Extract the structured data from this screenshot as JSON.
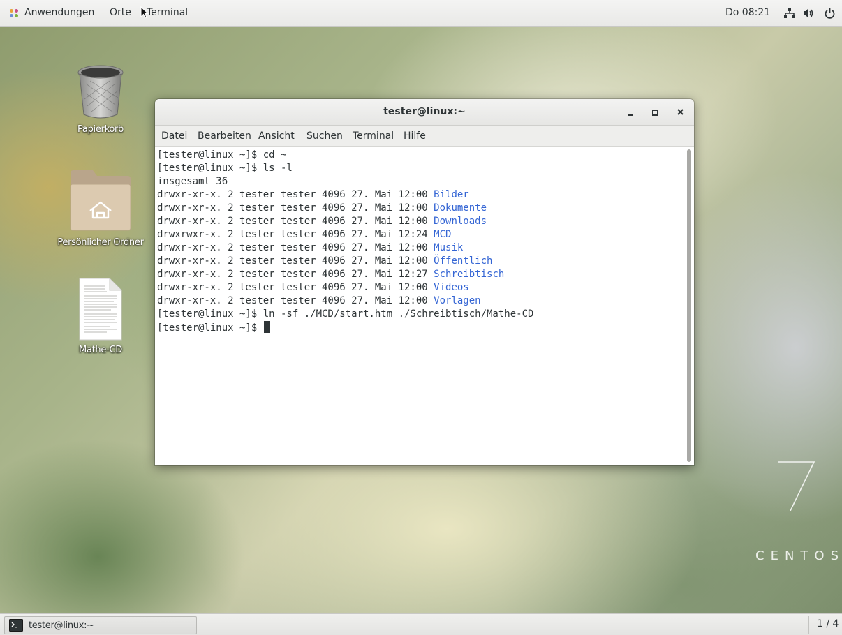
{
  "topbar": {
    "applications": "Anwendungen",
    "places": "Orte",
    "active_app": "Terminal",
    "clock": "Do 08:21"
  },
  "desktop": {
    "icons": [
      {
        "label": "Papierkorb",
        "icon": "trash-icon"
      },
      {
        "label": "Persönlicher Ordner",
        "icon": "home-folder-icon"
      },
      {
        "label": "Mathe-CD",
        "icon": "document-icon"
      }
    ],
    "logo": {
      "number": "7",
      "text": "CENTOS"
    }
  },
  "terminal": {
    "title": "tester@linux:~",
    "menu": [
      "Datei",
      "Bearbeiten",
      "Ansicht",
      "Suchen",
      "Terminal",
      "Hilfe"
    ],
    "lines": [
      {
        "text": "[tester@linux ~]$ cd ~",
        "name": ""
      },
      {
        "text": "[tester@linux ~]$ ls -l",
        "name": ""
      },
      {
        "text": "insgesamt 36",
        "name": ""
      },
      {
        "text": "drwxr-xr-x. 2 tester tester 4096 27. Mai 12:00 ",
        "name": "Bilder"
      },
      {
        "text": "drwxr-xr-x. 2 tester tester 4096 27. Mai 12:00 ",
        "name": "Dokumente"
      },
      {
        "text": "drwxr-xr-x. 2 tester tester 4096 27. Mai 12:00 ",
        "name": "Downloads"
      },
      {
        "text": "drwxrwxr-x. 2 tester tester 4096 27. Mai 12:24 ",
        "name": "MCD"
      },
      {
        "text": "drwxr-xr-x. 2 tester tester 4096 27. Mai 12:00 ",
        "name": "Musik"
      },
      {
        "text": "drwxr-xr-x. 2 tester tester 4096 27. Mai 12:00 ",
        "name": "Öffentlich"
      },
      {
        "text": "drwxr-xr-x. 2 tester tester 4096 27. Mai 12:27 ",
        "name": "Schreibtisch"
      },
      {
        "text": "drwxr-xr-x. 2 tester tester 4096 27. Mai 12:00 ",
        "name": "Videos"
      },
      {
        "text": "drwxr-xr-x. 2 tester tester 4096 27. Mai 12:00 ",
        "name": "Vorlagen"
      },
      {
        "text": "[tester@linux ~]$ ln -sf ./MCD/start.htm ./Schreibtisch/Mathe-CD",
        "name": ""
      },
      {
        "text": "[tester@linux ~]$ ",
        "name": "",
        "cursor": true
      }
    ]
  },
  "taskbar": {
    "window_label": "tester@linux:~",
    "workspace": "1 / 4"
  },
  "colors": {
    "directory": "#3465d4",
    "terminal_text": "#2e3436",
    "panel": "#ececea"
  }
}
